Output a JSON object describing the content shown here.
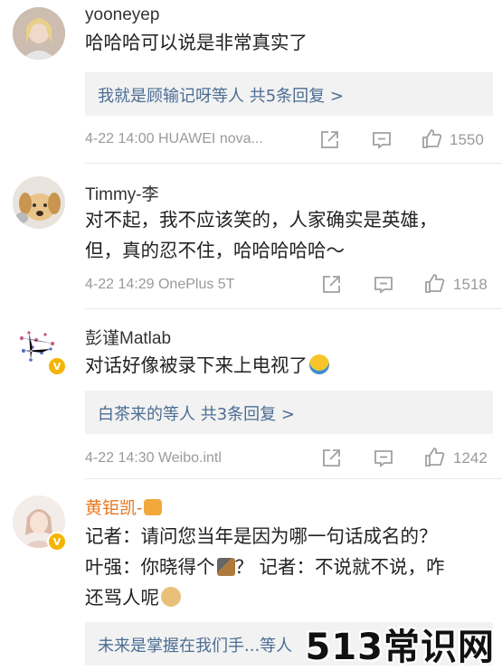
{
  "comments": [
    {
      "username": "yooneyep",
      "text_lines": [
        "哈哈哈可以说是非常真实了"
      ],
      "reply_summary": "我就是顾输记呀等人  共5条回复 >",
      "time": "4-22 14:00",
      "device": "HUAWEI nova...",
      "likes": "1550"
    },
    {
      "username": "Timmy-李",
      "text_lines": [
        "对不起，我不应该笑的，人家确实是英雄，",
        "但，真的忍不住，哈哈哈哈哈～"
      ],
      "time": "4-22 14:29",
      "device": "OnePlus 5T",
      "likes": "1518"
    },
    {
      "username": "彭谨Matlab",
      "text_lines": [
        "对话好像被录下来上电视了"
      ],
      "reply_summary": "白茶来的等人  共3条回复 >",
      "time": "4-22 14:30",
      "device": "Weibo.intl",
      "likes": "1242"
    },
    {
      "username": "黄钜凯-",
      "text_lines": [
        "记者：请问您当年是因为哪一句话成名的？",
        "叶强：你晓得个",
        "？  记者：不说就不说，咋",
        "还骂人呢"
      ],
      "reply_summary": "未来是掌握在我们手...等人"
    }
  ],
  "watermark": "513常识网",
  "colors": {
    "link": "#4c6d94",
    "meta": "#9a9a9a",
    "reply_bg": "#f2f2f2",
    "vip_name": "#e8761f",
    "verified_badge": "#f5b400"
  },
  "icons": [
    "avatar",
    "share-icon",
    "comment-icon",
    "like-icon",
    "verified-badge-icon",
    "laughing-crying-emoji",
    "hammer-emoji",
    "doge-emoji",
    "crown-emoji"
  ]
}
